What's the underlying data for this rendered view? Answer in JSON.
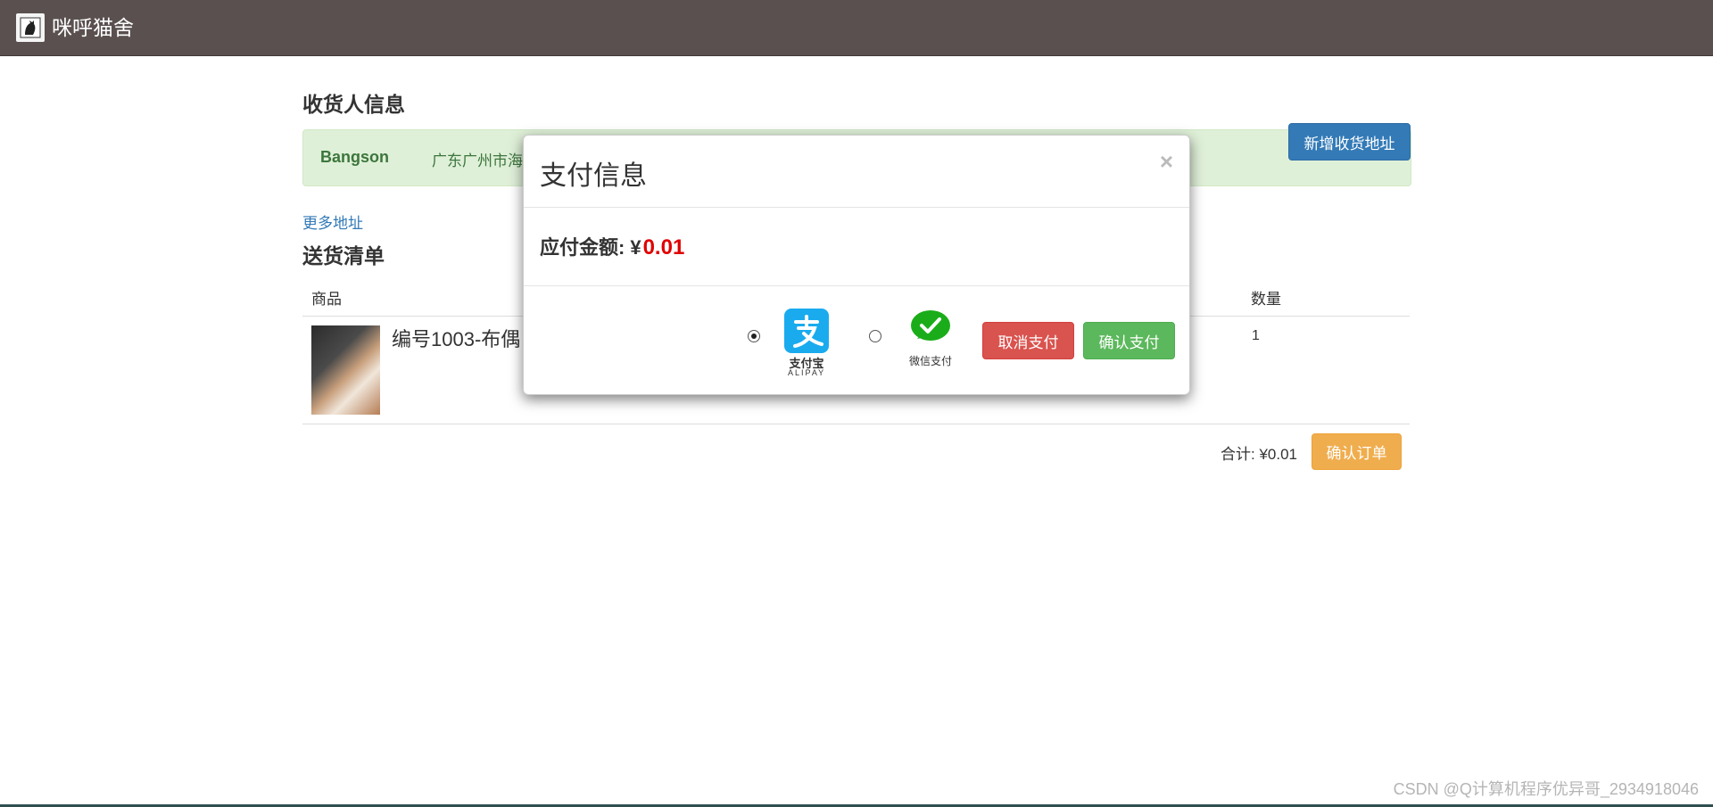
{
  "navbar": {
    "brand": "咪呼猫舍"
  },
  "receiver": {
    "heading": "收货人信息",
    "name": "Bangson",
    "address": "广东广州市海",
    "add_button": "新增收货地址",
    "more_link": "更多地址"
  },
  "delivery": {
    "heading": "送货清单",
    "columns": [
      "商品",
      "数量"
    ],
    "rows": [
      {
        "name": "编号1003-布偶",
        "quantity": "1"
      }
    ],
    "total_label": "合计: ¥0.01",
    "confirm_order_button": "确认订单"
  },
  "payment_modal": {
    "title": "支付信息",
    "close": "×",
    "amount_label": "应付金额:",
    "currency": "¥",
    "amount": "0.01",
    "methods": [
      {
        "name": "支付宝",
        "sub": "ALIPAY",
        "selected": true,
        "icon": "alipay-icon",
        "color": "#1aabef"
      },
      {
        "name": "微信支付",
        "selected": false,
        "icon": "wechat-pay-icon",
        "color": "#1aad19"
      }
    ],
    "cancel_button": "取消支付",
    "confirm_button": "确认支付"
  },
  "watermark": "CSDN @Q计算机程序优异哥_2934918046",
  "colors": {
    "navbar": "#5a5050",
    "primary": "#337ab7",
    "danger": "#d9534f",
    "success": "#5cb85c",
    "warning": "#f0ad4e",
    "amount": "#e00000"
  }
}
